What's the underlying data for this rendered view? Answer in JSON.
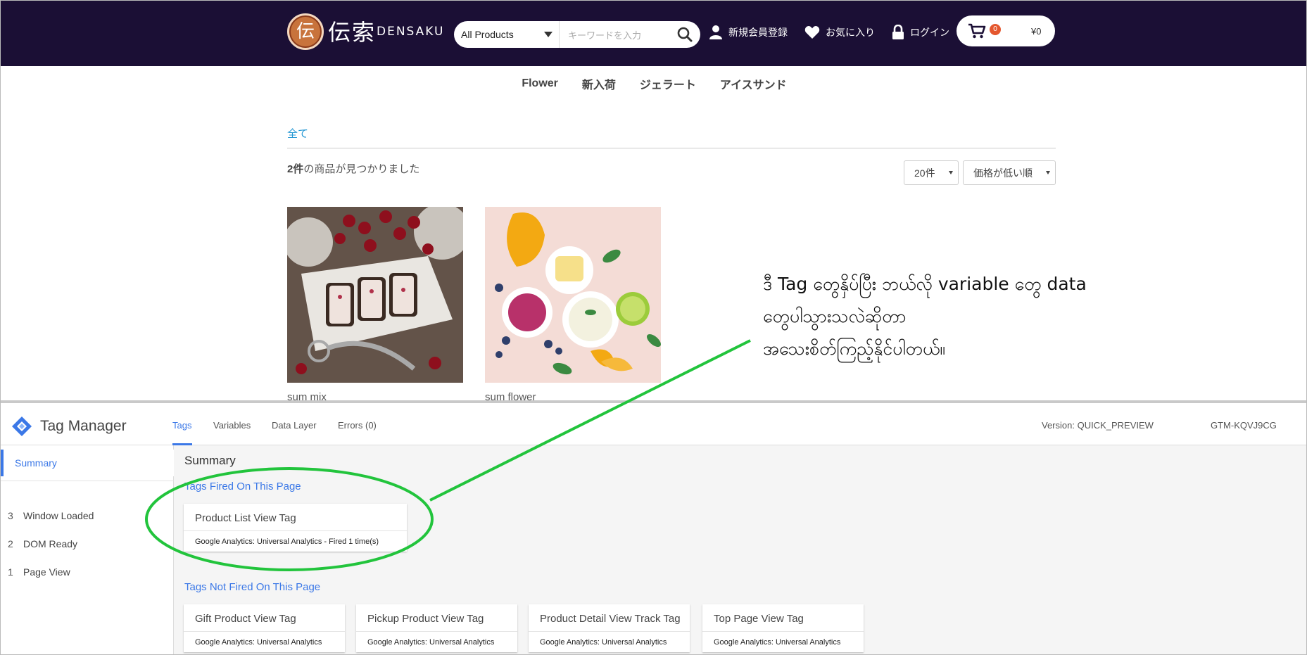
{
  "header": {
    "logo_seal_char": "伝",
    "logo_kanji": "伝索",
    "logo_roman": "DENSAKU",
    "search_category": "All Products",
    "search_placeholder": "キーワードを入力",
    "signup_label": "新規会員登録",
    "favorites_label": "お気に入り",
    "login_label": "ログイン",
    "cart_count": "0",
    "cart_total": "¥0"
  },
  "categories": [
    "Flower",
    "新入荷",
    "ジェラート",
    "アイスサンド"
  ],
  "breadcrumb": "全て",
  "results": {
    "count": "2件",
    "suffix": "の商品が見つかりました"
  },
  "sort": {
    "per_page": "20件",
    "order": "価格が低い順"
  },
  "products": [
    {
      "name": "sum mix"
    },
    {
      "name": "sum flower"
    }
  ],
  "annotation": {
    "line1": "ဒီ Tag တွေနှိပ်ပြီး ဘယ်လို variable တွေ data",
    "line2": "တွေပါသွားသလဲဆိုတာ",
    "line3": "အသေးစိတ်ကြည့်နိုင်ပါတယ်။"
  },
  "gtm": {
    "title": "Tag Manager",
    "tabs": [
      "Tags",
      "Variables",
      "Data Layer",
      "Errors (0)"
    ],
    "version": "Version: QUICK_PREVIEW",
    "container_id": "GTM-KQVJ9CG",
    "sidebar": {
      "summary": "Summary",
      "events": [
        {
          "num": "3",
          "label": "Window Loaded"
        },
        {
          "num": "2",
          "label": "DOM Ready"
        },
        {
          "num": "1",
          "label": "Page View"
        }
      ]
    },
    "summary_title": "Summary",
    "fired_title": "Tags Fired On This Page",
    "fired_tags": [
      {
        "name": "Product List View Tag",
        "type": "Google Analytics: Universal Analytics - Fired 1 time(s)"
      }
    ],
    "not_fired_title": "Tags Not Fired On This Page",
    "not_fired_tags": [
      {
        "name": "Gift Product View Tag",
        "type": "Google Analytics: Universal Analytics"
      },
      {
        "name": "Pickup Product View Tag",
        "type": "Google Analytics: Universal Analytics"
      },
      {
        "name": "Product Detail View Track Tag",
        "type": "Google Analytics: Universal Analytics"
      },
      {
        "name": "Top Page View Tag",
        "type": "Google Analytics: Universal Analytics"
      }
    ]
  },
  "colors": {
    "header_bg": "#1b0f35",
    "gtm_accent": "#3b78e7",
    "annotation_green": "#22c43c",
    "cart_badge": "#e4572e"
  }
}
